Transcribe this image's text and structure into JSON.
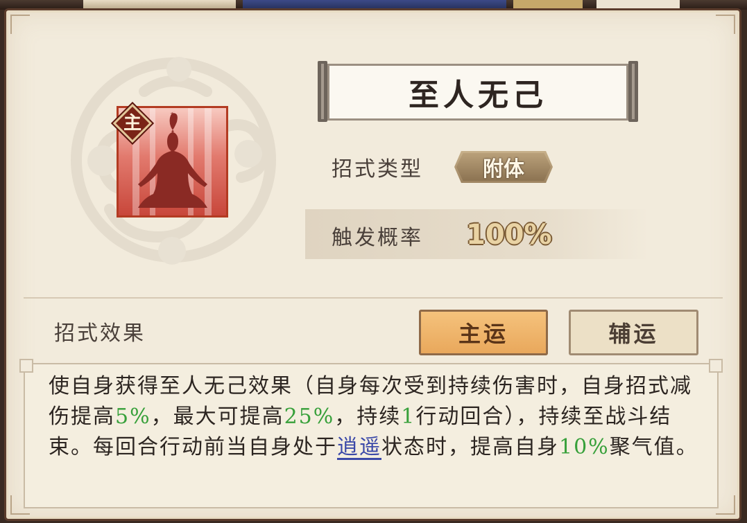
{
  "skill": {
    "name": "至人无己",
    "main_badge": "主",
    "icon": "meditating-figure-icon"
  },
  "info": {
    "type_label": "招式类型",
    "type_value": "附体",
    "rate_label": "触发概率",
    "rate_value": "100%"
  },
  "effects": {
    "section_label": "招式效果",
    "tab_main": "主运",
    "tab_assist": "辅运",
    "selected_tab": "主运",
    "description": {
      "p1": "使自身获得至人无己效果（自身每次受到持续伤害时，自身招式减伤提高",
      "v1": "5%",
      "p2": "，最大可提高",
      "v2": "25%",
      "p3": "，持续",
      "v3": "1",
      "p4": "行动回合），持续至战斗结束。每回合行动前当自身处于",
      "link": "逍遥",
      "p5": "状态时，提高自身",
      "v4": "10%",
      "p6": "聚气值。"
    }
  },
  "colors": {
    "highlight_green": "#37a03a",
    "link_blue": "#3b49a8",
    "tab_active": "#f0b86e",
    "panel_bg": "#f2ebdc"
  }
}
